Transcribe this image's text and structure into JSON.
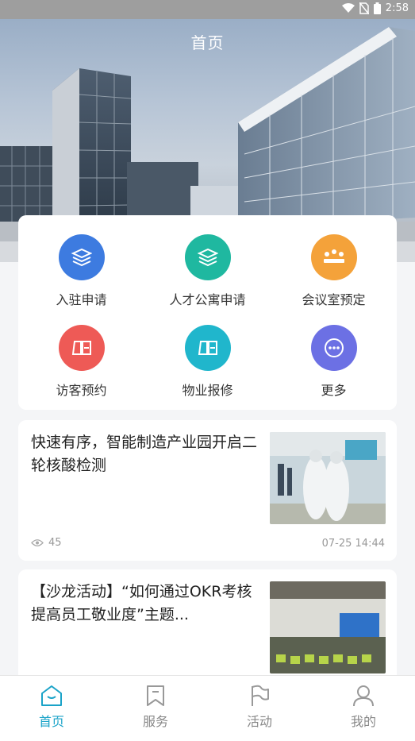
{
  "status_bar": {
    "time": "2:58"
  },
  "header": {
    "title": "首页"
  },
  "grid": [
    {
      "label": "入驻申请",
      "icon": "stack-icon",
      "color": "#3d7be0"
    },
    {
      "label": "人才公寓申请",
      "icon": "stack-icon",
      "color": "#1fb8a0"
    },
    {
      "label": "会议室预定",
      "icon": "meeting-icon",
      "color": "#f4a23a"
    },
    {
      "label": "访客预约",
      "icon": "panels-icon",
      "color": "#ee5a56"
    },
    {
      "label": "物业报修",
      "icon": "panels-icon",
      "color": "#20b6cc"
    },
    {
      "label": "更多",
      "icon": "more-icon",
      "color": "#6c70e4"
    }
  ],
  "news": [
    {
      "title": "快速有序，智能制造产业园开启二轮核酸检测",
      "views": "45",
      "time": "07-25 14:44"
    },
    {
      "title": "【沙龙活动】“如何通过OKR考核提高员工敬业度”主题..."
    }
  ],
  "tabs": [
    {
      "label": "首页",
      "icon": "home-icon",
      "active": true
    },
    {
      "label": "服务",
      "icon": "bookmark-icon",
      "active": false
    },
    {
      "label": "活动",
      "icon": "flag-icon",
      "active": false
    },
    {
      "label": "我的",
      "icon": "user-icon",
      "active": false
    }
  ],
  "colors": {
    "accent": "#1aa3c8",
    "status_bar": "#9e9e9e"
  }
}
